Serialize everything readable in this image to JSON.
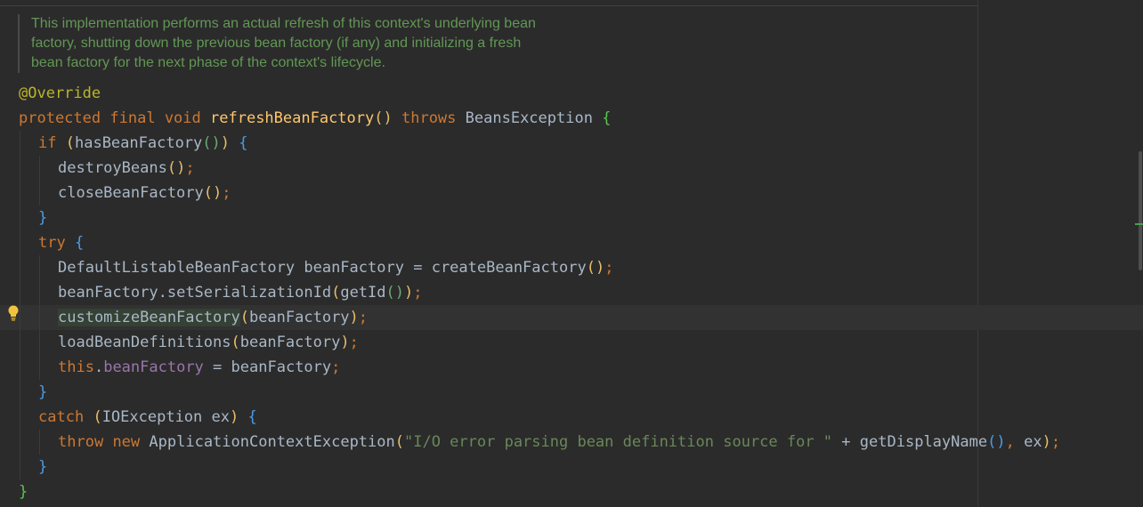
{
  "doc_comment": [
    "This implementation performs an actual refresh of this context's underlying bean",
    "factory, shutting down the previous bean factory (if any) and initializing a fresh",
    "bean factory for the next phase of the context's lifecycle."
  ],
  "icons": {
    "intention": "lightbulb-icon"
  },
  "colors": {
    "background": "#2b2b2b",
    "keyword": "#cc7832",
    "method": "#ffc66d",
    "annotation": "#bbb529",
    "string": "#6a8759",
    "field": "#9876aa",
    "comment": "#629755"
  },
  "code": {
    "annotation": "@Override",
    "decl": {
      "mod1": "protected",
      "mod2": "final",
      "ret": "void",
      "name": "refreshBeanFactory",
      "throws": "throws",
      "exc": "BeansException"
    },
    "l3": {
      "kw": "if",
      "call": "hasBeanFactory"
    },
    "l4": {
      "call": "destroyBeans"
    },
    "l5": {
      "call": "closeBeanFactory"
    },
    "l7": {
      "kw": "try"
    },
    "l8": {
      "type": "DefaultListableBeanFactory",
      "var": "beanFactory",
      "eq": "=",
      "call": "createBeanFactory"
    },
    "l9": {
      "obj": "beanFactory",
      "dot": ".",
      "call": "setSerializationId",
      "inner": "getId"
    },
    "l10": {
      "call": "customizeBeanFactory",
      "arg": "beanFactory"
    },
    "l11": {
      "call": "loadBeanDefinitions",
      "arg": "beanFactory"
    },
    "l12": {
      "kw": "this",
      "dot": ".",
      "field": "beanFactory",
      "eq": "=",
      "rhs": "beanFactory"
    },
    "l14": {
      "kw": "catch",
      "type": "IOException",
      "var": "ex"
    },
    "l15": {
      "kw1": "throw",
      "kw2": "new",
      "type": "ApplicationContextException",
      "str": "\"I/O error parsing bean definition source for \"",
      "plus": "+",
      "call": "getDisplayName",
      "arg": "ex"
    }
  }
}
